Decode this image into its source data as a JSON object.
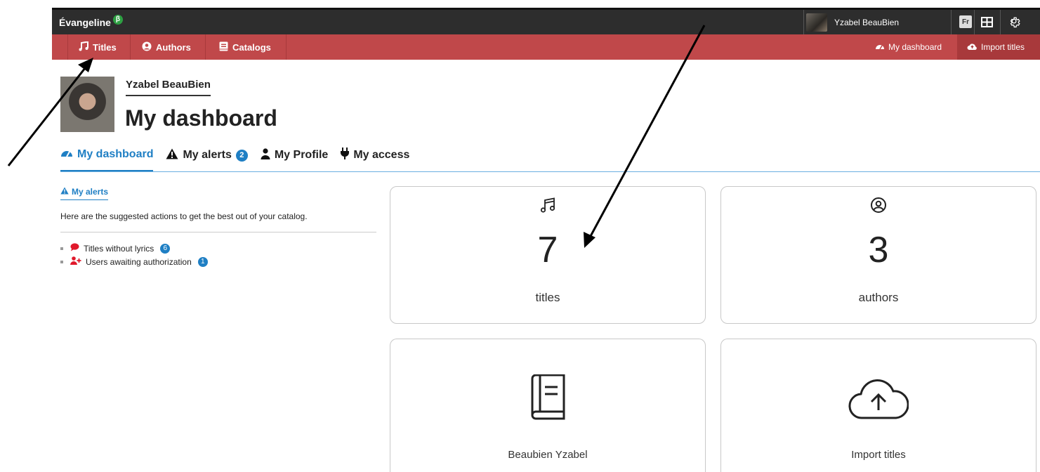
{
  "topbar": {
    "brand": "Évangeline",
    "beta": "β",
    "user_name": "Yzabel BeauBien",
    "lang": "Fr"
  },
  "nav": {
    "items": [
      {
        "label": "Titles",
        "icon": "music-icon"
      },
      {
        "label": "Authors",
        "icon": "user-circle-icon"
      },
      {
        "label": "Catalogs",
        "icon": "book-icon"
      }
    ],
    "right": [
      {
        "label": "My dashboard",
        "icon": "dashboard-icon"
      },
      {
        "label": "Import titles",
        "icon": "cloud-upload-icon"
      }
    ]
  },
  "header": {
    "user_name": "Yzabel BeauBien",
    "title": "My dashboard"
  },
  "tabs": [
    {
      "label": "My dashboard",
      "icon": "dashboard-icon",
      "active": true
    },
    {
      "label": "My alerts",
      "icon": "warning-icon",
      "badge": "2"
    },
    {
      "label": "My Profile",
      "icon": "user-icon"
    },
    {
      "label": "My access",
      "icon": "plug-icon"
    }
  ],
  "alerts": {
    "heading": "My alerts",
    "description": "Here are the suggested actions to get the best out of your catalog.",
    "items": [
      {
        "label": "Titles without lyrics",
        "badge": "6",
        "icon": "comment-icon"
      },
      {
        "label": "Users awaiting authorization",
        "badge": "1",
        "icon": "user-plus-icon"
      }
    ]
  },
  "cards": {
    "titles": {
      "count": "7",
      "label": "titles",
      "icon": "music-icon"
    },
    "authors": {
      "count": "3",
      "label": "authors",
      "icon": "user-circle-icon"
    },
    "catalog": {
      "label": "Beaubien Yzabel",
      "icon": "book-icon"
    },
    "import": {
      "label": "Import titles",
      "icon": "cloud-upload-icon"
    }
  },
  "colors": {
    "topbar": "#2d2d2d",
    "navbar": "#c0484a",
    "accent": "#1f7fc4",
    "beta": "#2ea043"
  }
}
